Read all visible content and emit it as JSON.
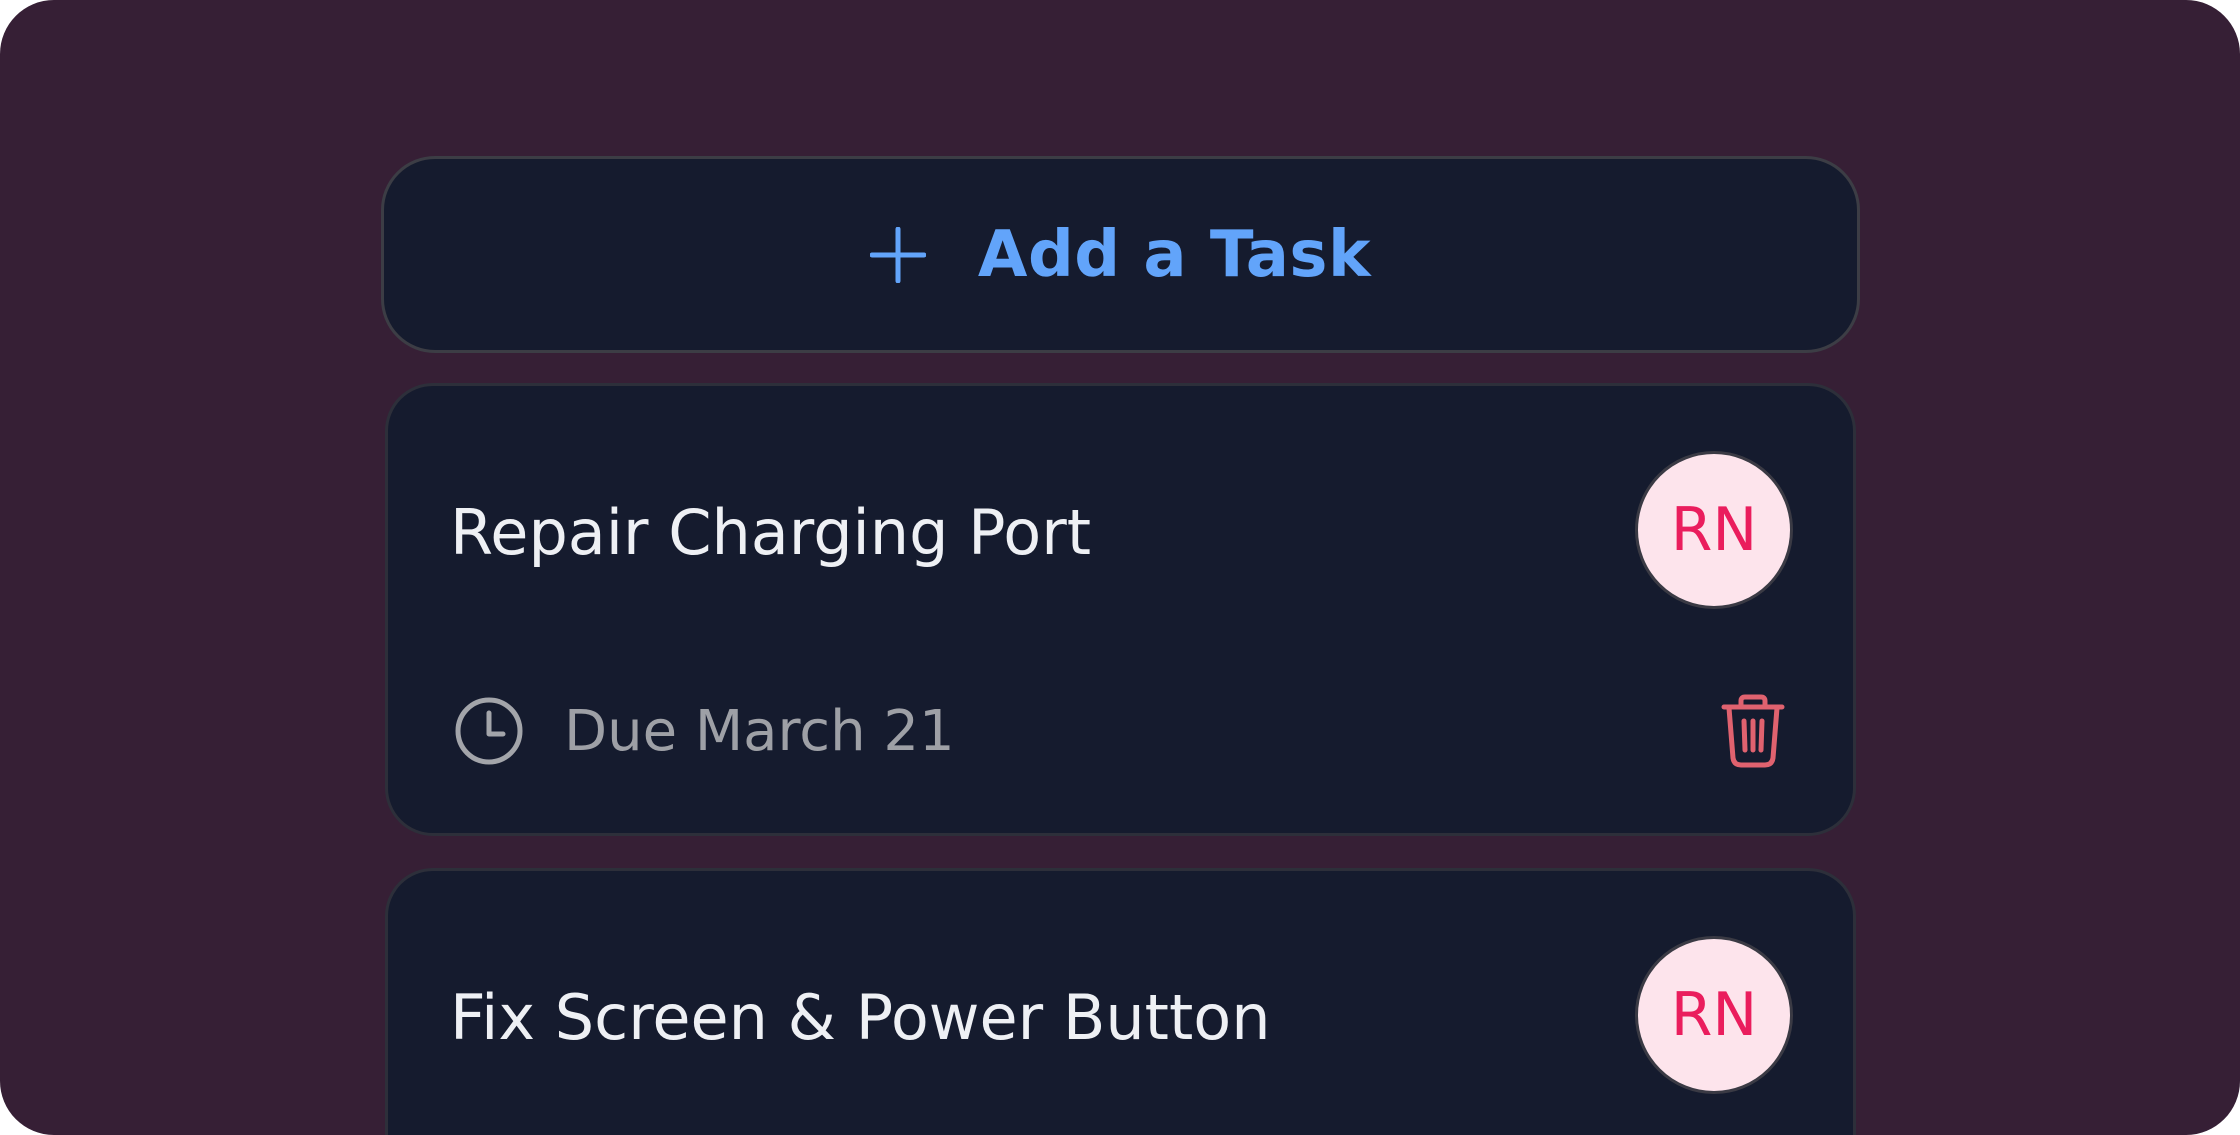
{
  "add_task": {
    "label": "Add a Task",
    "icon": "plus-icon"
  },
  "tasks": [
    {
      "title": "Repair Charging Port",
      "assignee_initials": "RN",
      "due_label": "Due March 21",
      "icons": {
        "due": "clock-icon",
        "delete": "trash-icon"
      }
    },
    {
      "title": "Fix Screen & Power Button",
      "assignee_initials": "RN"
    }
  ],
  "colors": {
    "background": "#361f35",
    "card": "#151b2e",
    "accent": "#62a4fa",
    "avatar_bg": "#fde4ec",
    "avatar_text": "#ea1d5d",
    "delete": "#e0626f",
    "muted_text": "#9ea0a6"
  }
}
